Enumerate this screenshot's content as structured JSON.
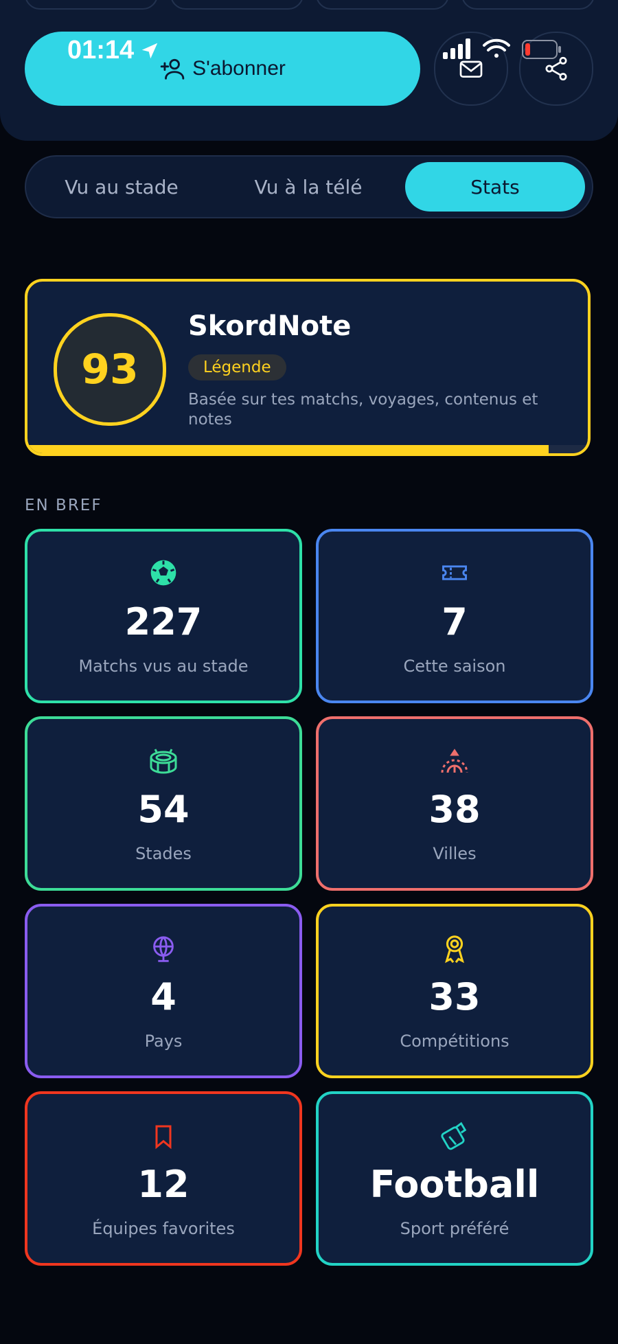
{
  "status": {
    "time": "01:14"
  },
  "header": {
    "subscribe_label": "S'abonner"
  },
  "tabs": [
    {
      "label": "Vu au stade"
    },
    {
      "label": "Vu à la télé"
    },
    {
      "label": "Stats"
    }
  ],
  "score": {
    "title": "SkordNote",
    "value": "93",
    "level": "Légende",
    "description": "Basée sur tes matchs, voyages, contenus et notes",
    "progress": 0.93
  },
  "section": {
    "label": "EN BREF"
  },
  "stats": [
    {
      "value": "227",
      "label": "Matchs vus au stade",
      "color": "#2ee0a8",
      "icon": "soccer-ball-icon"
    },
    {
      "value": "7",
      "label": "Cette saison",
      "color": "#4a86f0",
      "icon": "ticket-icon"
    },
    {
      "value": "54",
      "label": "Stades",
      "color": "#3ddc97",
      "icon": "stadium-icon"
    },
    {
      "value": "38",
      "label": "Villes",
      "color": "#ef6f6c",
      "icon": "travel-arc-icon"
    },
    {
      "value": "4",
      "label": "Pays",
      "color": "#8a5cf0",
      "icon": "globe-icon"
    },
    {
      "value": "33",
      "label": "Compétitions",
      "color": "#ffd21f",
      "icon": "medal-icon"
    },
    {
      "value": "12",
      "label": "Équipes favorites",
      "color": "#f0361f",
      "icon": "bookmark-icon"
    },
    {
      "value": "Football",
      "label": "Sport préféré",
      "color": "#22d3c5",
      "icon": "whistle-icon"
    }
  ],
  "colors": {
    "accent": "#31d6e6",
    "gold": "#ffd21f",
    "card": "#0f1f3d",
    "background": "#04070f"
  }
}
